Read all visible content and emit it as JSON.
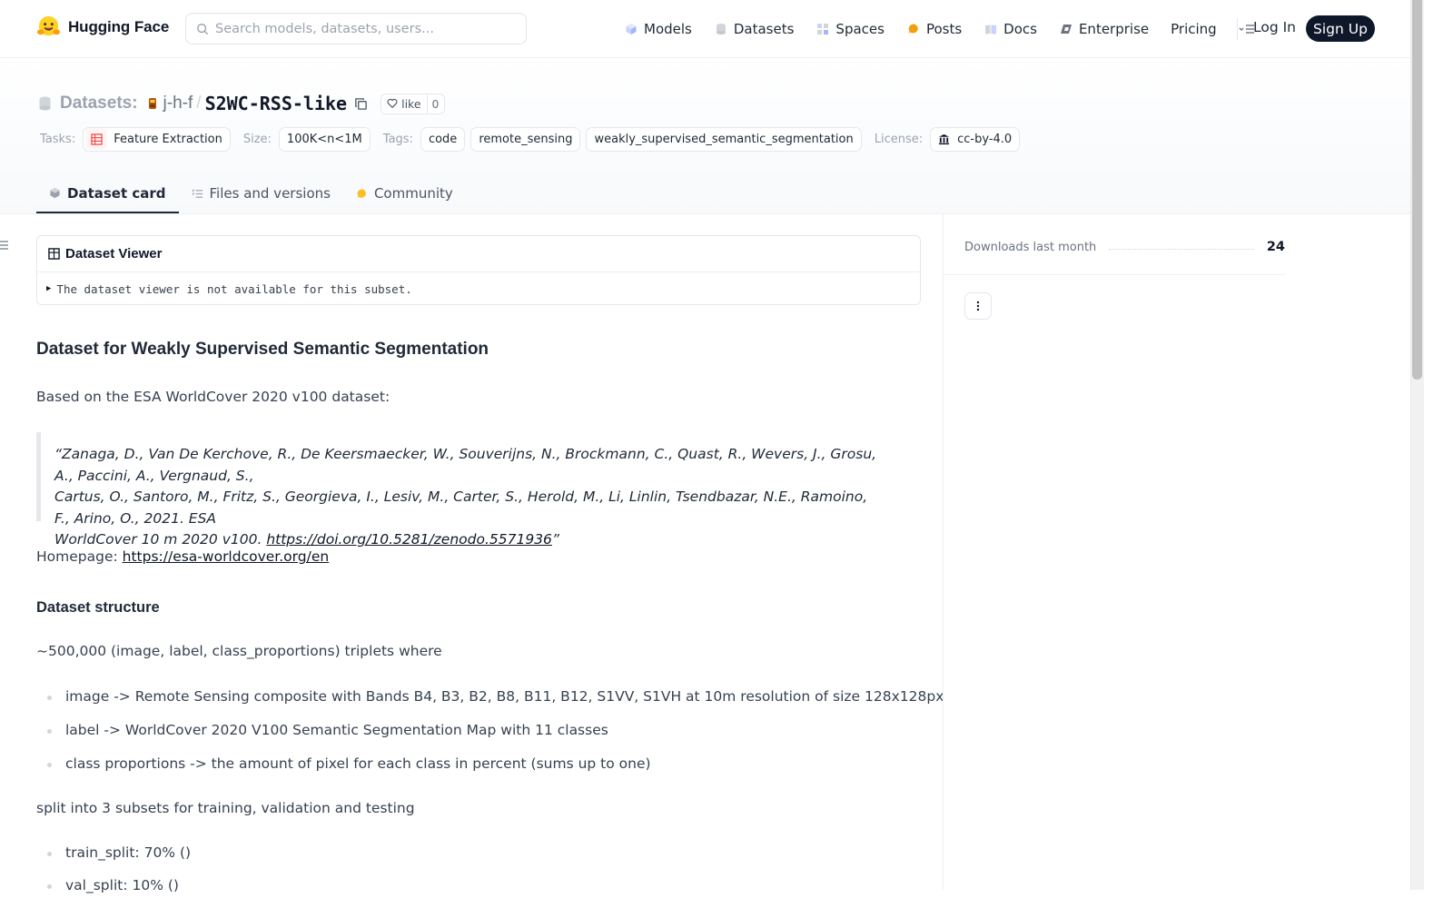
{
  "nav": {
    "brand": "Hugging Face",
    "search_placeholder": "Search models, datasets, users...",
    "links": [
      {
        "label": "Models",
        "icon": "cube-icon"
      },
      {
        "label": "Datasets",
        "icon": "database-icon"
      },
      {
        "label": "Spaces",
        "icon": "grid-icon"
      },
      {
        "label": "Posts",
        "icon": "chat-bubble-icon"
      },
      {
        "label": "Docs",
        "icon": "book-icon"
      },
      {
        "label": "Enterprise",
        "icon": "enterprise-icon"
      },
      {
        "label": "Pricing",
        "icon": ""
      }
    ],
    "login": "Log In",
    "signup": "Sign Up"
  },
  "header": {
    "section_label": "Datasets:",
    "owner": "j-h-f",
    "separator": "/",
    "repo": "S2WC-RSS-like",
    "like_label": "like",
    "like_count": "0",
    "tasks_label": "Tasks:",
    "task": "Feature Extraction",
    "size_label": "Size:",
    "size": "100K<n<1M",
    "tags_label": "Tags:",
    "tags": [
      "code",
      "remote_sensing",
      "weakly_supervised_semantic_segmentation"
    ],
    "license_label": "License:",
    "license": "cc-by-4.0"
  },
  "tabs": [
    {
      "label": "Dataset card",
      "active": true
    },
    {
      "label": "Files and versions",
      "active": false
    },
    {
      "label": "Community",
      "active": false
    }
  ],
  "viewer": {
    "title": "Dataset Viewer",
    "message": "The dataset viewer is not available for this subset."
  },
  "card": {
    "h2": "Dataset for Weakly Supervised Semantic Segmentation",
    "intro": "Based on the ESA WorldCover 2020 v100 dataset:",
    "quote_l1": "“Zanaga, D., Van De Kerchove, R., De Keersmaecker, W., Souverijns, N., Brockmann, C., Quast, R., Wevers, J., Grosu, A., Paccini, A., Vergnaud, S.,",
    "quote_l2": "Cartus, O., Santoro, M., Fritz, S., Georgieva, I., Lesiv, M., Carter, S., Herold, M., Li, Linlin, Tsendbazar, N.E., Ramoino, F., Arino, O., 2021. ESA",
    "quote_l3": "WorldCover 10 m 2020 v100. ",
    "quote_link": "https://doi.org/10.5281/zenodo.5571936",
    "quote_end": "”",
    "homepage_label": "Homepage: ",
    "homepage_link": "https://esa-worldcover.org/en",
    "structure_h3": "Dataset structure",
    "triplets": "~500,000 (image, label, class_proportions) triplets where",
    "bullets": [
      "image -> Remote Sensing composite with Bands B4, B3, B2, B8, B11, B12, S1VV, S1VH at 10m resolution of size 128x128px",
      "label -> WorldCover 2020 V100 Semantic Segmentation Map with 11 classes",
      "class proportions -> the amount of pixel for each class in percent (sums up to one)"
    ],
    "split_text": "split into 3 subsets for training, validation and testing",
    "splits": [
      "train_split: 70% ()",
      "val_split: 10% ()"
    ]
  },
  "sidebar": {
    "downloads_label": "Downloads last month",
    "downloads_count": "24"
  },
  "colors": {
    "accent_dark": "#0f172a",
    "task_icon": "#ef4444",
    "hf_yellow": "#FFD21E"
  }
}
